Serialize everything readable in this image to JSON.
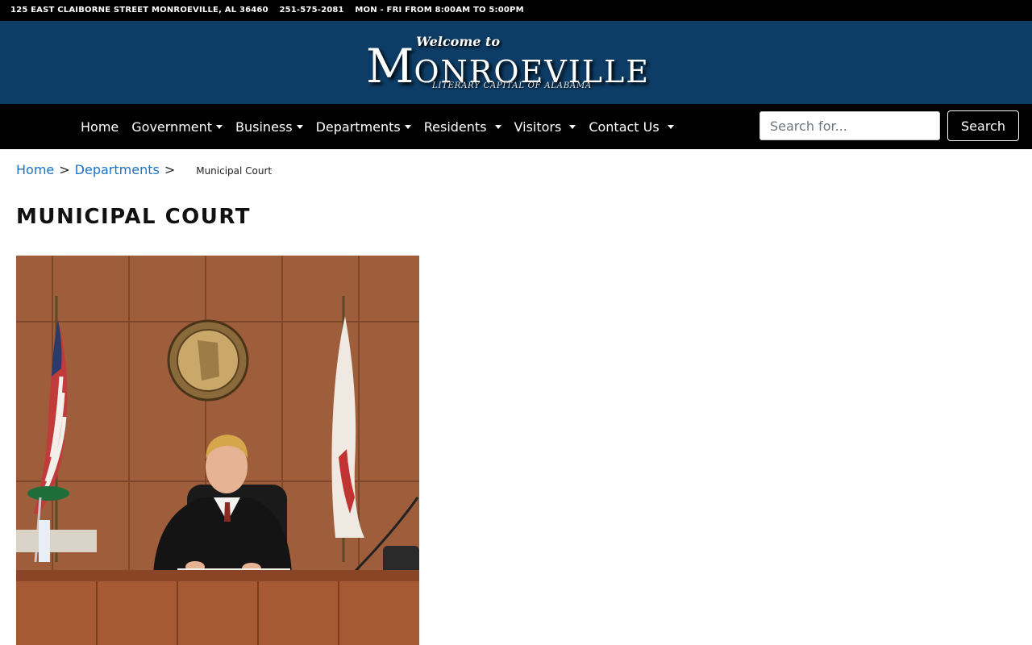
{
  "topbar": {
    "address": "125 EAST CLAIBORNE STREET MONROEVILLE, AL 36460",
    "phone": "251-575-2081",
    "hours": "MON - FRI FROM 8:00AM TO 5:00PM"
  },
  "logo": {
    "welcome": "Welcome to",
    "initial": "M",
    "name_rest": "ONROEVILLE",
    "tagline": "LITERARY CAPITAL OF ALABAMA"
  },
  "nav": {
    "items": [
      {
        "label": "Home"
      },
      {
        "label": "Government"
      },
      {
        "label": "Business"
      },
      {
        "label": "Departments"
      },
      {
        "label": "Residents"
      },
      {
        "label": "Visitors"
      },
      {
        "label": "Contact Us"
      }
    ]
  },
  "search": {
    "placeholder": "Search for...",
    "button_label": "Search"
  },
  "breadcrumb": {
    "home": "Home",
    "section": "Departments",
    "separator": ">",
    "current": "Municipal Court"
  },
  "page": {
    "title": "MUNICIPAL COURT"
  },
  "colors": {
    "banner": "#0d3d66",
    "nav_background": "#000000",
    "link": "#1a73c7"
  }
}
